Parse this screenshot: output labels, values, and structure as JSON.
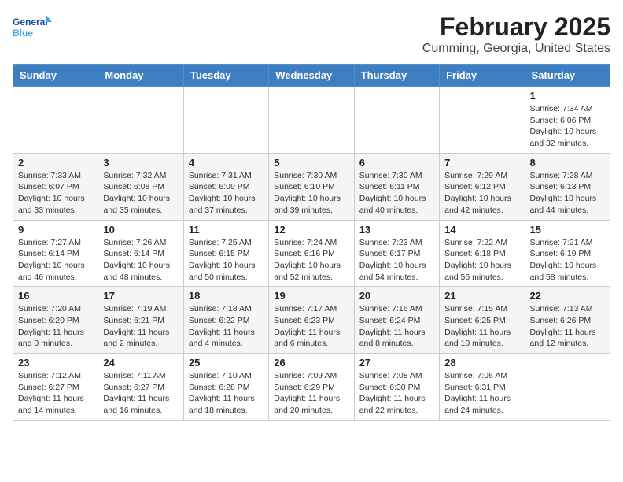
{
  "logo": {
    "general": "General",
    "blue": "Blue"
  },
  "title": "February 2025",
  "subtitle": "Cumming, Georgia, United States",
  "days_of_week": [
    "Sunday",
    "Monday",
    "Tuesday",
    "Wednesday",
    "Thursday",
    "Friday",
    "Saturday"
  ],
  "weeks": [
    [
      {
        "day": "",
        "info": ""
      },
      {
        "day": "",
        "info": ""
      },
      {
        "day": "",
        "info": ""
      },
      {
        "day": "",
        "info": ""
      },
      {
        "day": "",
        "info": ""
      },
      {
        "day": "",
        "info": ""
      },
      {
        "day": "1",
        "info": "Sunrise: 7:34 AM\nSunset: 6:06 PM\nDaylight: 10 hours and 32 minutes."
      }
    ],
    [
      {
        "day": "2",
        "info": "Sunrise: 7:33 AM\nSunset: 6:07 PM\nDaylight: 10 hours and 33 minutes."
      },
      {
        "day": "3",
        "info": "Sunrise: 7:32 AM\nSunset: 6:08 PM\nDaylight: 10 hours and 35 minutes."
      },
      {
        "day": "4",
        "info": "Sunrise: 7:31 AM\nSunset: 6:09 PM\nDaylight: 10 hours and 37 minutes."
      },
      {
        "day": "5",
        "info": "Sunrise: 7:30 AM\nSunset: 6:10 PM\nDaylight: 10 hours and 39 minutes."
      },
      {
        "day": "6",
        "info": "Sunrise: 7:30 AM\nSunset: 6:11 PM\nDaylight: 10 hours and 40 minutes."
      },
      {
        "day": "7",
        "info": "Sunrise: 7:29 AM\nSunset: 6:12 PM\nDaylight: 10 hours and 42 minutes."
      },
      {
        "day": "8",
        "info": "Sunrise: 7:28 AM\nSunset: 6:13 PM\nDaylight: 10 hours and 44 minutes."
      }
    ],
    [
      {
        "day": "9",
        "info": "Sunrise: 7:27 AM\nSunset: 6:14 PM\nDaylight: 10 hours and 46 minutes."
      },
      {
        "day": "10",
        "info": "Sunrise: 7:26 AM\nSunset: 6:14 PM\nDaylight: 10 hours and 48 minutes."
      },
      {
        "day": "11",
        "info": "Sunrise: 7:25 AM\nSunset: 6:15 PM\nDaylight: 10 hours and 50 minutes."
      },
      {
        "day": "12",
        "info": "Sunrise: 7:24 AM\nSunset: 6:16 PM\nDaylight: 10 hours and 52 minutes."
      },
      {
        "day": "13",
        "info": "Sunrise: 7:23 AM\nSunset: 6:17 PM\nDaylight: 10 hours and 54 minutes."
      },
      {
        "day": "14",
        "info": "Sunrise: 7:22 AM\nSunset: 6:18 PM\nDaylight: 10 hours and 56 minutes."
      },
      {
        "day": "15",
        "info": "Sunrise: 7:21 AM\nSunset: 6:19 PM\nDaylight: 10 hours and 58 minutes."
      }
    ],
    [
      {
        "day": "16",
        "info": "Sunrise: 7:20 AM\nSunset: 6:20 PM\nDaylight: 11 hours and 0 minutes."
      },
      {
        "day": "17",
        "info": "Sunrise: 7:19 AM\nSunset: 6:21 PM\nDaylight: 11 hours and 2 minutes."
      },
      {
        "day": "18",
        "info": "Sunrise: 7:18 AM\nSunset: 6:22 PM\nDaylight: 11 hours and 4 minutes."
      },
      {
        "day": "19",
        "info": "Sunrise: 7:17 AM\nSunset: 6:23 PM\nDaylight: 11 hours and 6 minutes."
      },
      {
        "day": "20",
        "info": "Sunrise: 7:16 AM\nSunset: 6:24 PM\nDaylight: 11 hours and 8 minutes."
      },
      {
        "day": "21",
        "info": "Sunrise: 7:15 AM\nSunset: 6:25 PM\nDaylight: 11 hours and 10 minutes."
      },
      {
        "day": "22",
        "info": "Sunrise: 7:13 AM\nSunset: 6:26 PM\nDaylight: 11 hours and 12 minutes."
      }
    ],
    [
      {
        "day": "23",
        "info": "Sunrise: 7:12 AM\nSunset: 6:27 PM\nDaylight: 11 hours and 14 minutes."
      },
      {
        "day": "24",
        "info": "Sunrise: 7:11 AM\nSunset: 6:27 PM\nDaylight: 11 hours and 16 minutes."
      },
      {
        "day": "25",
        "info": "Sunrise: 7:10 AM\nSunset: 6:28 PM\nDaylight: 11 hours and 18 minutes."
      },
      {
        "day": "26",
        "info": "Sunrise: 7:09 AM\nSunset: 6:29 PM\nDaylight: 11 hours and 20 minutes."
      },
      {
        "day": "27",
        "info": "Sunrise: 7:08 AM\nSunset: 6:30 PM\nDaylight: 11 hours and 22 minutes."
      },
      {
        "day": "28",
        "info": "Sunrise: 7:06 AM\nSunset: 6:31 PM\nDaylight: 11 hours and 24 minutes."
      },
      {
        "day": "",
        "info": ""
      }
    ]
  ]
}
